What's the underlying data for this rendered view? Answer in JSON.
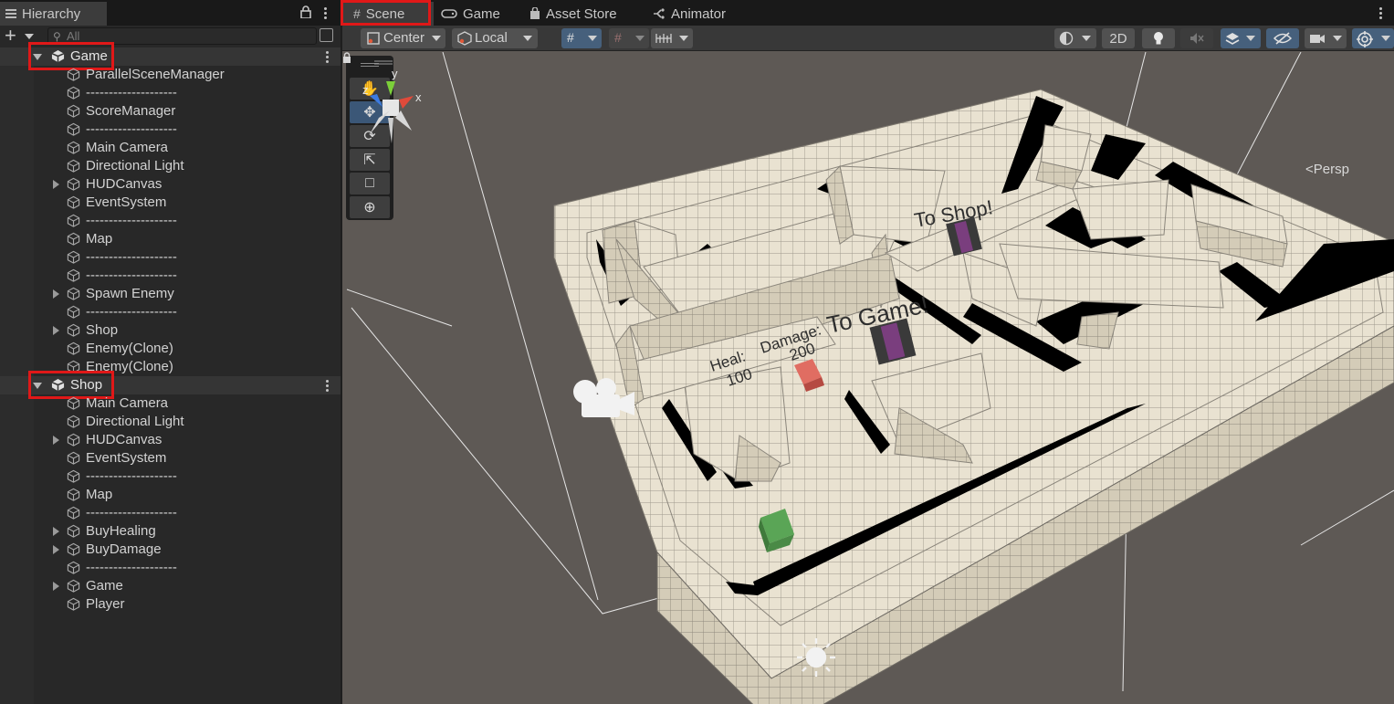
{
  "hierarchy": {
    "tab_label": "Hierarchy",
    "search_placeholder": "All",
    "add_label": "+",
    "rows": [
      {
        "label": "Game",
        "kind": "scene",
        "fold": "open",
        "level": 0,
        "highlight": true
      },
      {
        "label": "ParallelSceneManager",
        "kind": "object",
        "fold": "none",
        "level": 1
      },
      {
        "label": "--------------------",
        "kind": "object",
        "fold": "none",
        "level": 1
      },
      {
        "label": "ScoreManager",
        "kind": "object",
        "fold": "none",
        "level": 1
      },
      {
        "label": "--------------------",
        "kind": "object",
        "fold": "none",
        "level": 1
      },
      {
        "label": "Main Camera",
        "kind": "object",
        "fold": "none",
        "level": 1
      },
      {
        "label": "Directional Light",
        "kind": "object",
        "fold": "none",
        "level": 1
      },
      {
        "label": "HUDCanvas",
        "kind": "object",
        "fold": "closed",
        "level": 1
      },
      {
        "label": "EventSystem",
        "kind": "object",
        "fold": "none",
        "level": 1
      },
      {
        "label": "--------------------",
        "kind": "object",
        "fold": "none",
        "level": 1
      },
      {
        "label": "Map",
        "kind": "object",
        "fold": "none",
        "level": 1
      },
      {
        "label": "--------------------",
        "kind": "object",
        "fold": "none",
        "level": 1
      },
      {
        "label": "--------------------",
        "kind": "object",
        "fold": "none",
        "level": 1
      },
      {
        "label": "Spawn Enemy",
        "kind": "object",
        "fold": "closed",
        "level": 1
      },
      {
        "label": "--------------------",
        "kind": "object",
        "fold": "none",
        "level": 1
      },
      {
        "label": "Shop",
        "kind": "object",
        "fold": "closed",
        "level": 1
      },
      {
        "label": "Enemy(Clone)",
        "kind": "object",
        "fold": "none",
        "level": 1
      },
      {
        "label": "Enemy(Clone)",
        "kind": "object",
        "fold": "none",
        "level": 1
      },
      {
        "label": "Shop",
        "kind": "scene",
        "fold": "open",
        "level": 0,
        "highlight": true
      },
      {
        "label": "Main Camera",
        "kind": "object",
        "fold": "none",
        "level": 1
      },
      {
        "label": "Directional Light",
        "kind": "object",
        "fold": "none",
        "level": 1
      },
      {
        "label": "HUDCanvas",
        "kind": "object",
        "fold": "closed",
        "level": 1
      },
      {
        "label": "EventSystem",
        "kind": "object",
        "fold": "none",
        "level": 1
      },
      {
        "label": "--------------------",
        "kind": "object",
        "fold": "none",
        "level": 1
      },
      {
        "label": "Map",
        "kind": "object",
        "fold": "none",
        "level": 1
      },
      {
        "label": "--------------------",
        "kind": "object",
        "fold": "none",
        "level": 1
      },
      {
        "label": "BuyHealing",
        "kind": "object",
        "fold": "closed",
        "level": 1
      },
      {
        "label": "BuyDamage",
        "kind": "object",
        "fold": "closed",
        "level": 1
      },
      {
        "label": "--------------------",
        "kind": "object",
        "fold": "none",
        "level": 1
      },
      {
        "label": "Game",
        "kind": "object",
        "fold": "closed",
        "level": 1
      },
      {
        "label": "Player",
        "kind": "object",
        "fold": "none",
        "level": 1
      }
    ]
  },
  "scene_tabs": [
    {
      "label": "Scene",
      "icon": "grid-icon",
      "active": true
    },
    {
      "label": "Game",
      "icon": "gamepad-icon",
      "active": false
    },
    {
      "label": "Asset Store",
      "icon": "bag-icon",
      "active": false
    },
    {
      "label": "Animator",
      "icon": "animator-icon",
      "active": false
    }
  ],
  "scene_toolbar": {
    "pivot_label": "Center",
    "space_label": "Local",
    "mode_2d_label": "2D"
  },
  "scene_view": {
    "texts": {
      "to_shop": "To Shop!",
      "to_game": "To Game!",
      "heal_label": "Heal:",
      "heal_value": "100",
      "damage_label": "Damage:",
      "damage_value": "200"
    },
    "gizmo": {
      "x": "x",
      "y": "y",
      "z": "z",
      "projection": "Persp"
    }
  },
  "colors": {
    "highlight_box": "#e01818",
    "floor": "#e9e2d1",
    "wall_side": "#cfc7b3",
    "portal_purple": "#7a3e7e",
    "player_green": "#5aa556",
    "pickup_red": "#e06d62",
    "gizmo_x": "#e04a3a",
    "gizmo_y": "#7ccf3a",
    "gizmo_z": "#3c7be0"
  }
}
